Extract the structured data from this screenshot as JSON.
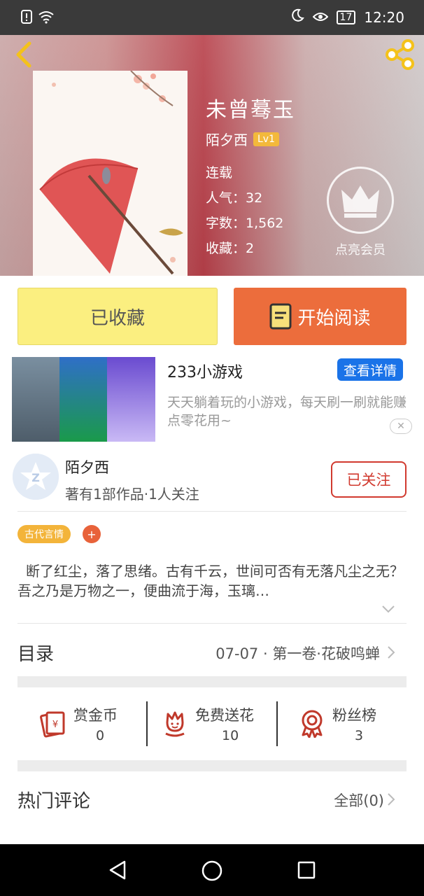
{
  "status_bar": {
    "time": "12:20",
    "battery": "17"
  },
  "book": {
    "title": "未曾蓦玉",
    "author": "陌夕西",
    "level": "Lv1",
    "status": "连载",
    "popularity": "人气：32",
    "word_count": "字数：1,562",
    "favorites": "收藏：2",
    "vip_label": "点亮会员"
  },
  "actions": {
    "collected": "已收藏",
    "start_reading": "开始阅读"
  },
  "ad": {
    "title": "233小游戏",
    "cta": "查看详情",
    "description": "天天躺着玩的小游戏，每天刷一刷就能赚点零花用~",
    "close": "✕"
  },
  "author_info": {
    "name": "陌夕西",
    "summary": "著有1部作品·1人关注",
    "follow_label": "已关注"
  },
  "tag": {
    "label": "古代言情",
    "add": "+"
  },
  "synopsis": "断了红尘，落了思绪。古有千云，世间可否有无落凡尘之无？吾之乃是万物之一，便曲流于海，玉璃…",
  "toc": {
    "label": "目录",
    "latest": "07-07 · 第一卷·花破鸣蝉"
  },
  "stats": {
    "reward": {
      "label": "赏金币",
      "value": "0"
    },
    "flowers": {
      "label": "免费送花",
      "value": "10"
    },
    "fans": {
      "label": "粉丝榜",
      "value": "3"
    }
  },
  "comments": {
    "label": "热门评论",
    "all": "全部(0)"
  },
  "colors": {
    "read_button": "#ec6d3c",
    "fav_button": "#fbef80",
    "accent_red": "#d13a2f",
    "tag": "#f3b43a",
    "ad_button": "#1a73e8"
  }
}
